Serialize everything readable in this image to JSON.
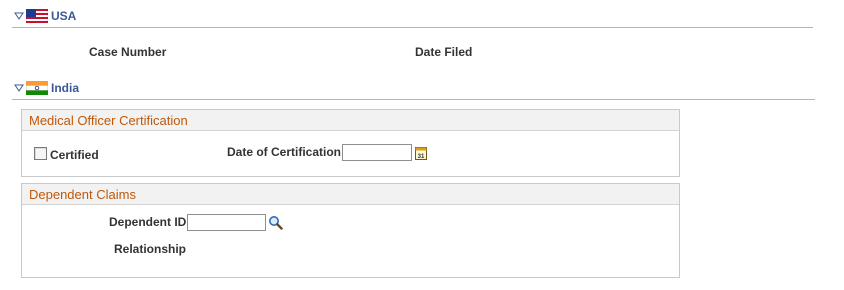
{
  "usa": {
    "title": "USA",
    "columns": {
      "case_number": "Case Number",
      "date_filed": "Date Filed"
    }
  },
  "india": {
    "title": "India",
    "medical_group": {
      "title": "Medical Officer Certification",
      "certified_label": "Certified",
      "certified_checked": false,
      "date_label": "Date of Certification",
      "date_value": "",
      "calendar_icon": "calendar-icon",
      "calendar_icon_text": "31"
    },
    "dependent_group": {
      "title": "Dependent Claims",
      "dependent_id_label": "Dependent ID",
      "dependent_id_value": "",
      "lookup_icon": "magnifier-icon",
      "relationship_label": "Relationship"
    }
  },
  "colors": {
    "section_title": "#3b5998",
    "group_title": "#c0580a",
    "group_header_bg": "#f2f2f2",
    "border": "#c9c9c9"
  }
}
